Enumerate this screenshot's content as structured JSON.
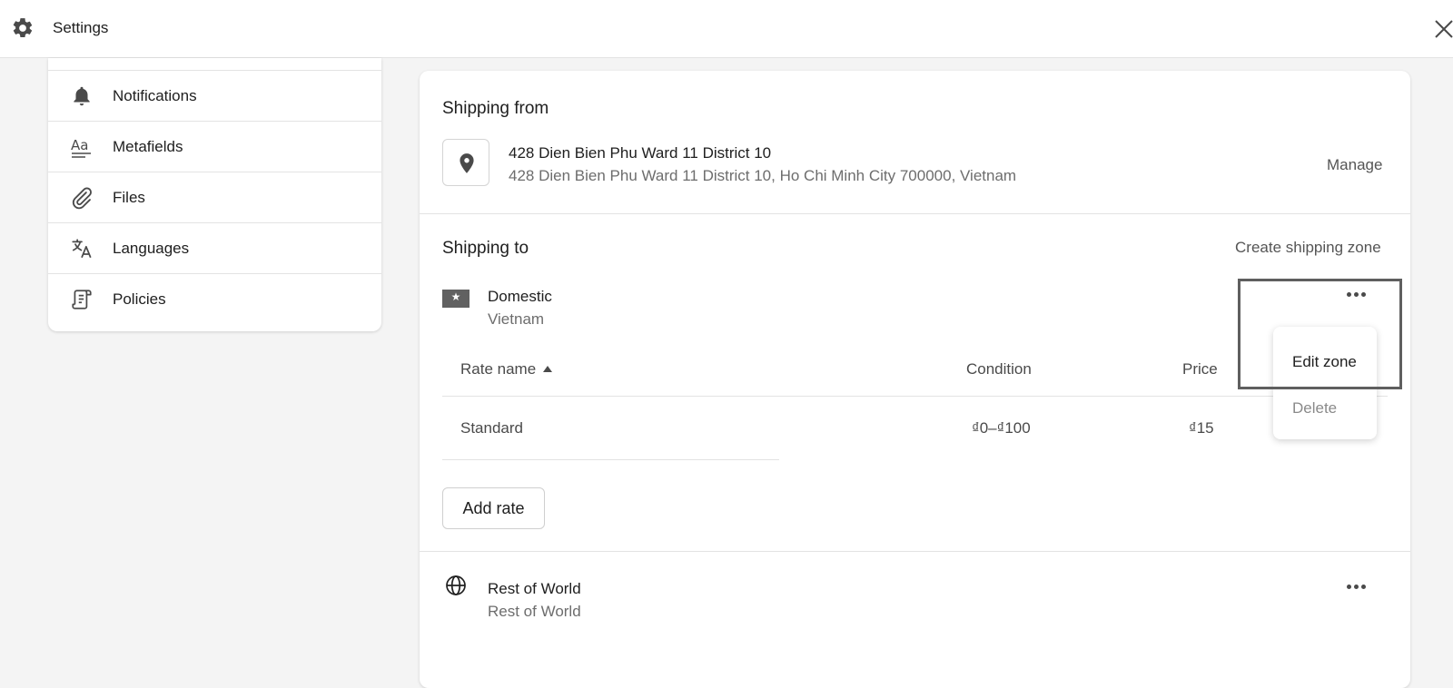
{
  "app": {
    "title": "Settings"
  },
  "sidebar": {
    "items": [
      {
        "label": "Notifications",
        "icon": "bell-icon"
      },
      {
        "label": "Metafields",
        "icon": "metafields-icon"
      },
      {
        "label": "Files",
        "icon": "paperclip-icon"
      },
      {
        "label": "Languages",
        "icon": "translate-icon"
      },
      {
        "label": "Policies",
        "icon": "policy-scroll-icon"
      }
    ]
  },
  "shipping_from": {
    "title": "Shipping from",
    "location_name": "428 Dien Bien Phu Ward 11 District 10",
    "location_address": "428 Dien Bien Phu Ward 11 District 10, Ho Chi Minh City 700000, Vietnam",
    "manage_label": "Manage"
  },
  "shipping_to": {
    "title": "Shipping to",
    "create_zone_label": "Create shipping zone",
    "zones": [
      {
        "name": "Domestic",
        "countries": "Vietnam",
        "rates_header": {
          "rate_name": "Rate name",
          "condition": "Condition",
          "price": "Price"
        },
        "rates": [
          {
            "name": "Standard",
            "condition": "₫0–₫100",
            "price": "₫15"
          }
        ],
        "add_rate_label": "Add rate"
      },
      {
        "name": "Rest of World",
        "countries": "Rest of World"
      }
    ]
  },
  "zone_menu": {
    "items": [
      {
        "label": "Edit zone",
        "enabled": true
      },
      {
        "label": "Delete",
        "enabled": false
      }
    ]
  },
  "colors": {
    "background": "#f4f4f4",
    "surface": "#ffffff",
    "border": "#e3e3e3",
    "text": "#202020",
    "muted_text": "#6d6d6d",
    "disabled_text": "#8a8a8a",
    "highlight_frame": "#5f5f5f"
  }
}
